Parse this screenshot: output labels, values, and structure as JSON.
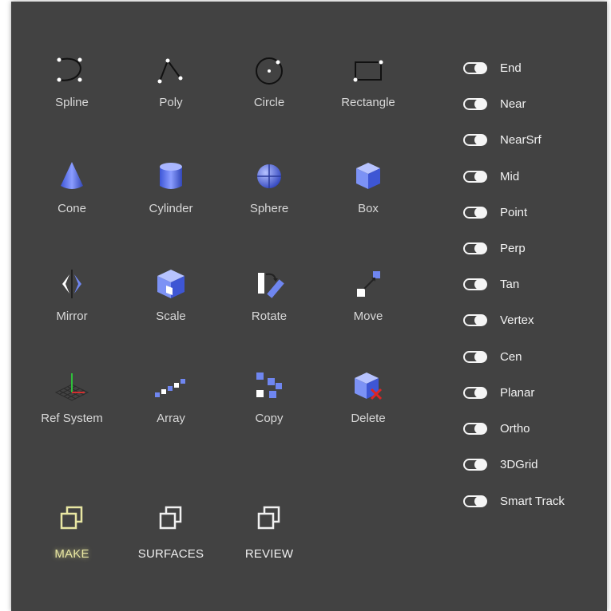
{
  "tools": [
    {
      "id": "spline",
      "label": "Spline",
      "icon": "spline-icon"
    },
    {
      "id": "poly",
      "label": "Poly",
      "icon": "poly-icon"
    },
    {
      "id": "circle",
      "label": "Circle",
      "icon": "circle-icon"
    },
    {
      "id": "rectangle",
      "label": "Rectangle",
      "icon": "rectangle-icon"
    },
    {
      "id": "cone",
      "label": "Cone",
      "icon": "cone-icon"
    },
    {
      "id": "cylinder",
      "label": "Cylinder",
      "icon": "cylinder-icon"
    },
    {
      "id": "sphere",
      "label": "Sphere",
      "icon": "sphere-icon"
    },
    {
      "id": "box",
      "label": "Box",
      "icon": "box-icon"
    },
    {
      "id": "mirror",
      "label": "Mirror",
      "icon": "mirror-icon"
    },
    {
      "id": "scale",
      "label": "Scale",
      "icon": "scale-icon"
    },
    {
      "id": "rotate",
      "label": "Rotate",
      "icon": "rotate-icon"
    },
    {
      "id": "move",
      "label": "Move",
      "icon": "move-icon"
    },
    {
      "id": "ref-system",
      "label": "Ref System",
      "icon": "ref-system-icon"
    },
    {
      "id": "array",
      "label": "Array",
      "icon": "array-icon"
    },
    {
      "id": "copy",
      "label": "Copy",
      "icon": "copy-icon"
    },
    {
      "id": "delete",
      "label": "Delete",
      "icon": "delete-icon"
    }
  ],
  "tabs": [
    {
      "id": "make",
      "label": "MAKE",
      "active": true,
      "icon": "layers-icon"
    },
    {
      "id": "surfaces",
      "label": "SURFACES",
      "active": false,
      "icon": "layers-icon"
    },
    {
      "id": "review",
      "label": "REVIEW",
      "active": false,
      "icon": "layers-icon"
    }
  ],
  "snaps": [
    {
      "label": "End",
      "on": true
    },
    {
      "label": "Near",
      "on": true
    },
    {
      "label": "NearSrf",
      "on": true
    },
    {
      "label": "Mid",
      "on": true
    },
    {
      "label": "Point",
      "on": true
    },
    {
      "label": "Perp",
      "on": true
    },
    {
      "label": "Tan",
      "on": true
    },
    {
      "label": "Vertex",
      "on": true
    },
    {
      "label": "Cen",
      "on": true
    },
    {
      "label": "Planar",
      "on": true
    },
    {
      "label": "Ortho",
      "on": true
    },
    {
      "label": "3DGrid",
      "on": true
    },
    {
      "label": "Smart Track",
      "on": true
    }
  ],
  "colors": {
    "panel": "#424242",
    "accent_blue": "#6f86f0",
    "active_tab": "#e9e7a3",
    "text": "#d8d8d8"
  }
}
